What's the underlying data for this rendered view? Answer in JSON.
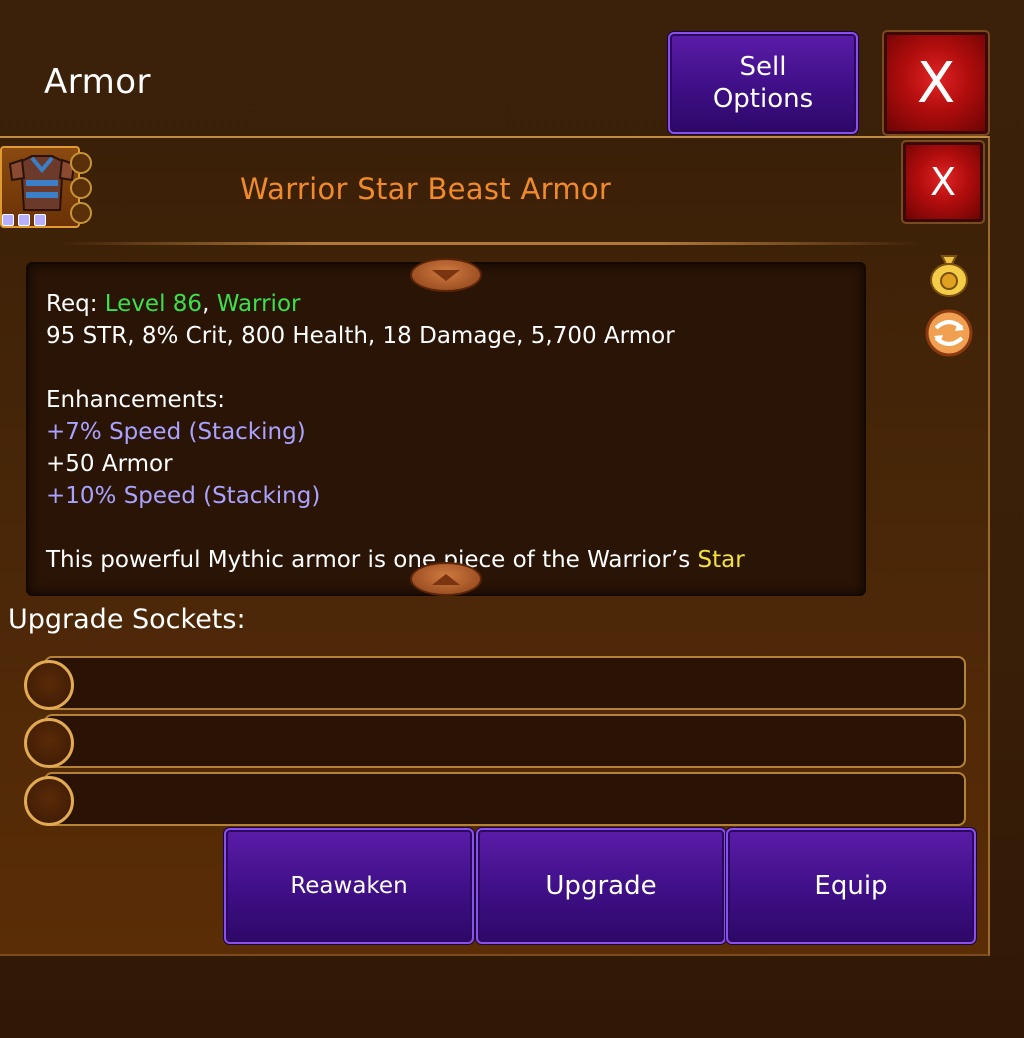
{
  "header": {
    "title": "Armor",
    "sell_button": "Sell Options",
    "close_label": "X"
  },
  "item": {
    "name": "Warrior Star Beast Armor",
    "close_label": "X"
  },
  "description": {
    "req_prefix": "Req: ",
    "req_level": "Level 86",
    "req_sep": ", ",
    "req_class": "Warrior",
    "stats": "95 STR, 8% Crit, 800 Health, 18 Damage, 5,700 Armor",
    "enhancements_heading": "Enhancements:",
    "enhancements": [
      "+7% Speed (Stacking)",
      "+50 Armor",
      "+10% Speed (Stacking)"
    ],
    "flavor_text": "This powerful Mythic armor is one piece of the Warrior’s ",
    "flavor_highlight": "Star"
  },
  "sockets": {
    "label": "Upgrade Sockets:",
    "count": 3
  },
  "actions": {
    "reawaken": "Reawaken",
    "upgrade": "Upgrade",
    "equip": "Equip"
  },
  "colors": {
    "title_orange": "#f08a2a",
    "req_green": "#3de04a",
    "enhancement_blue": "#a9a2ff",
    "highlight_yellow": "#f2e23a",
    "button_purple": "#4a1496",
    "close_red": "#c01414"
  },
  "icons": [
    "armor-item-icon",
    "gold-bag-icon",
    "swap-icon",
    "chevron-down-icon",
    "chevron-up-icon"
  ]
}
